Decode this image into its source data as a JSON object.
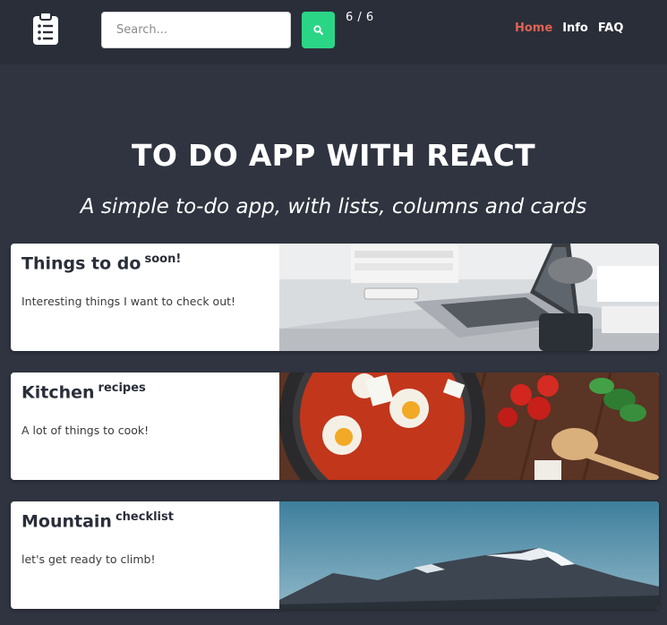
{
  "search": {
    "placeholder": "Search..."
  },
  "counter": "6 / 6",
  "nav": [
    {
      "label": "Home",
      "active": true
    },
    {
      "label": "Info",
      "active": false
    },
    {
      "label": "FAQ",
      "active": false
    }
  ],
  "hero": {
    "title": "TO DO APP WITH REACT",
    "subtitle": "A simple to-do app, with lists, columns and cards"
  },
  "cards": [
    {
      "title": "Things to do",
      "tag": "soon!",
      "description": "Interesting things I want to check out!",
      "image": "laptop-desk-photo"
    },
    {
      "title": "Kitchen",
      "tag": "recipes",
      "description": "A lot of things to cook!",
      "image": "shakshuka-pan-photo"
    },
    {
      "title": "Mountain",
      "tag": "checklist",
      "description": "let's get ready to climb!",
      "image": "snowy-mountain-photo"
    }
  ],
  "colors": {
    "page_bg": "#2f3440",
    "navbar_bg": "#2a2e39",
    "search_button": "#2bd586",
    "nav_active": "#e06352",
    "card_bg": "#ffffff"
  }
}
